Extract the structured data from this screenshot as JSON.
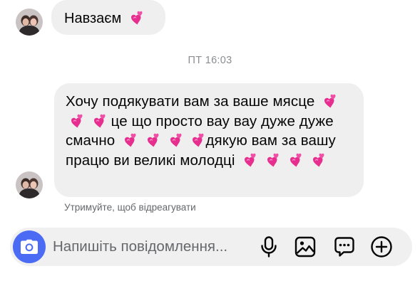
{
  "conversation": {
    "messages": [
      {
        "text_parts": [
          "Навзаєм "
        ],
        "emoji": "heart-emoji"
      },
      {
        "text_parts": [
          "Хочу подякувати вам за ваше мясце ",
          " це що просто вау вау дуже дуже смачно ",
          "дякую вам за вашу працю ви великі молодці "
        ],
        "emoji": "heart-emoji"
      }
    ],
    "timestamp": "ПТ 16:03",
    "reaction_hint": "Утримуйте, щоб відреагувати"
  },
  "composer": {
    "placeholder": "Напишіть повідомлення..."
  },
  "icons": {
    "camera": "camera-icon",
    "mic": "microphone-icon",
    "gallery": "image-icon",
    "sticker": "chat-dots-icon",
    "more": "plus-circle-icon"
  },
  "colors": {
    "accent": "#4b6bf5",
    "bubble": "#efefef",
    "heart": "#f03a9e"
  }
}
